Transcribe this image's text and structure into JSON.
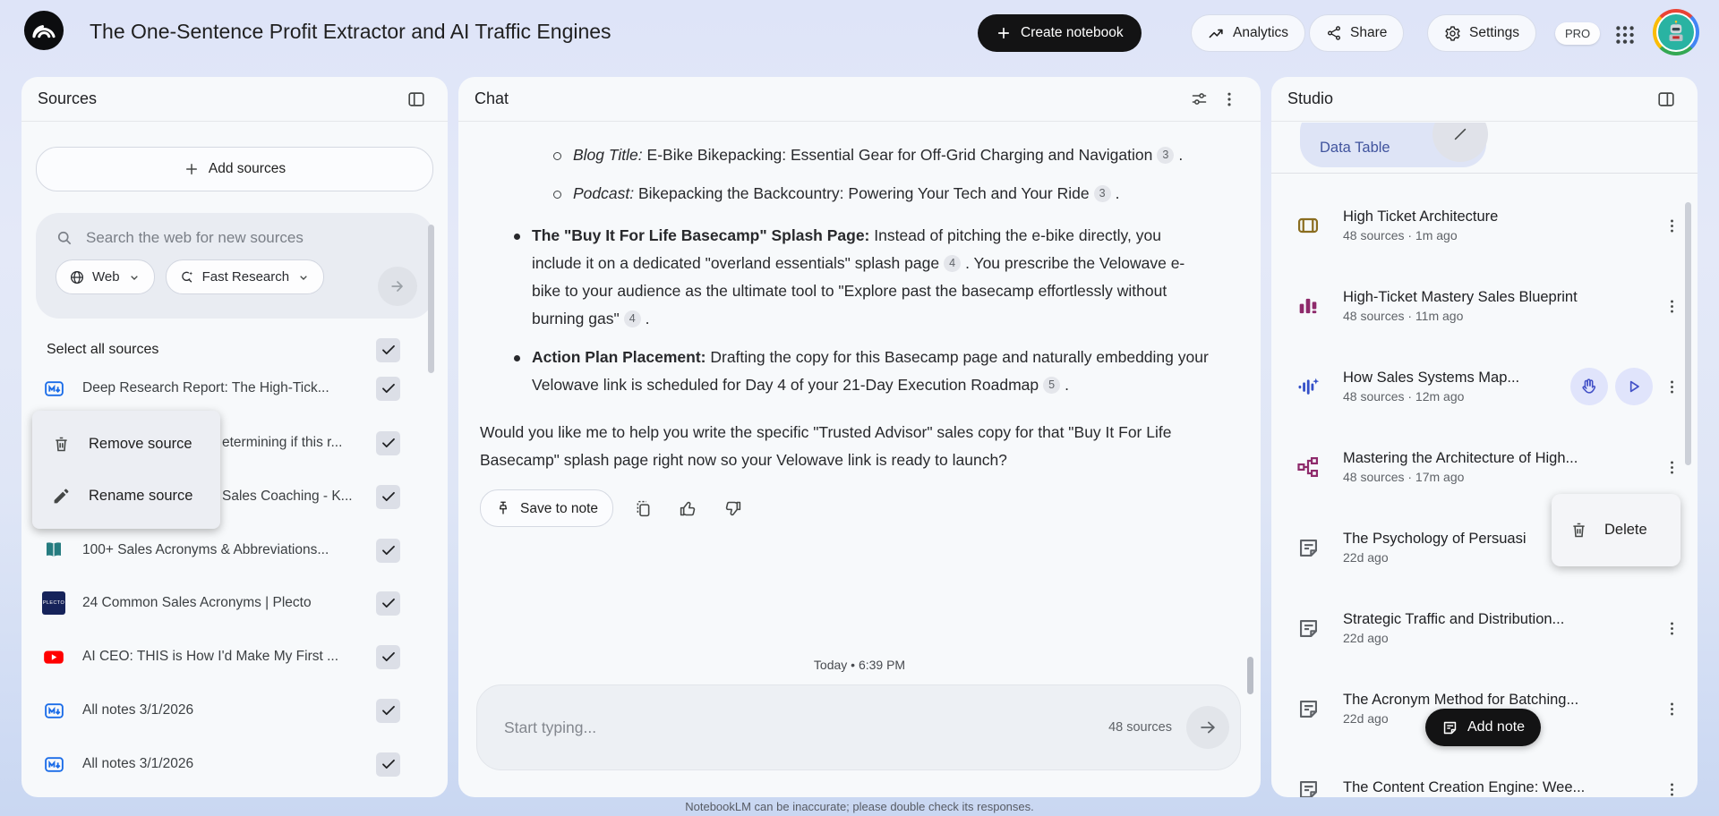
{
  "header": {
    "title": "The One-Sentence Profit Extractor and AI Traffic Engines",
    "create_notebook": "Create notebook",
    "analytics": "Analytics",
    "share": "Share",
    "settings": "Settings",
    "pro_badge": "PRO"
  },
  "sources": {
    "title": "Sources",
    "add_button": "Add sources",
    "search_placeholder": "Search the web for new sources",
    "web_filter": "Web",
    "research_mode": "Fast Research",
    "select_all": "Select all sources",
    "items": [
      {
        "title": "Deep Research Report: The High-Tick...",
        "icon": "note-source-icon"
      },
      {
        "title": "etermining if this r...",
        "icon": "hidden-behind-menu"
      },
      {
        "title": "Sales Coaching - K...",
        "icon": "hidden-behind-menu"
      },
      {
        "title": "100+ Sales Acronyms & Abbreviations...",
        "icon": "book-favicon"
      },
      {
        "title": "24 Common Sales Acronyms | Plecto",
        "icon": "plecto-favicon"
      },
      {
        "title": "AI CEO: THIS is How I'd Make My First ...",
        "icon": "youtube-favicon"
      },
      {
        "title": "All notes 3/1/2026",
        "icon": "note-source-icon"
      },
      {
        "title": "All notes 3/1/2026",
        "icon": "note-source-icon"
      }
    ],
    "context_menu": {
      "remove": "Remove source",
      "rename": "Rename source"
    }
  },
  "chat": {
    "title": "Chat",
    "sub_bullets": {
      "blog": {
        "label": "Blog Title:",
        "text": " E-Bike Bikepacking: Essential Gear for Off-Grid Charging and Navigation",
        "cite": "3",
        "after": "."
      },
      "podcast": {
        "label": "Podcast:",
        "text": " Bikepacking the Backcountry: Powering Your Tech and Your Ride",
        "cite": "3",
        "after": "."
      }
    },
    "splash_bullet": {
      "label": "The \"Buy It For Life Basecamp\" Splash Page:",
      "t1": " Instead of pitching the e-bike directly, you include it on a dedicated \"overland essentials\" splash page",
      "c1": "4",
      "t2": ". You prescribe the Velowave e-bike to your audience as the ultimate tool to \"Explore past the basecamp effortlessly without burning gas\"",
      "c2": "4",
      "t3": "."
    },
    "action_bullet": {
      "label": "Action Plan Placement:",
      "t1": " Drafting the copy for this Basecamp page and naturally embedding your Velowave link is scheduled for Day 4 of your 21-Day Execution Roadmap",
      "c1": "5",
      "t2": "."
    },
    "closing": "Would you like me to help you write the specific \"Trusted Advisor\" sales copy for that \"Buy It For Life Basecamp\" splash page right now so your Velowave link is ready to launch?",
    "save_to_note": "Save to note",
    "timestamp": "Today • 6:39 PM",
    "input_placeholder": "Start typing...",
    "source_count": "48 sources"
  },
  "studio": {
    "title": "Studio",
    "data_table_chip": "Data Table",
    "items": [
      {
        "title": "High Ticket Architecture",
        "meta": "48 sources · 1m ago",
        "icon": "flashcards-icon"
      },
      {
        "title": "High-Ticket Mastery Sales Blueprint",
        "meta": "48 sources · 11m ago",
        "icon": "report-icon"
      },
      {
        "title": "How Sales Systems Map...",
        "meta": "48 sources · 12m ago",
        "icon": "audio-overview-icon"
      },
      {
        "title": "Mastering the Architecture of High...",
        "meta": "48 sources · 17m ago",
        "icon": "mindmap-icon"
      },
      {
        "title": "The Psychology of Persuasi",
        "meta": "22d ago",
        "icon": "note-icon"
      },
      {
        "title": "Strategic Traffic and Distribution...",
        "meta": "22d ago",
        "icon": "note-icon"
      },
      {
        "title": "The Acronym Method for Batching...",
        "meta": "22d ago",
        "icon": "note-icon"
      },
      {
        "title": "The Content Creation Engine: Wee...",
        "meta": "",
        "icon": "note-icon"
      }
    ],
    "delete_menu": "Delete",
    "add_note": "Add note"
  },
  "footer": {
    "disclaimer": "NotebookLM can be inaccurate; please double check its responses."
  }
}
